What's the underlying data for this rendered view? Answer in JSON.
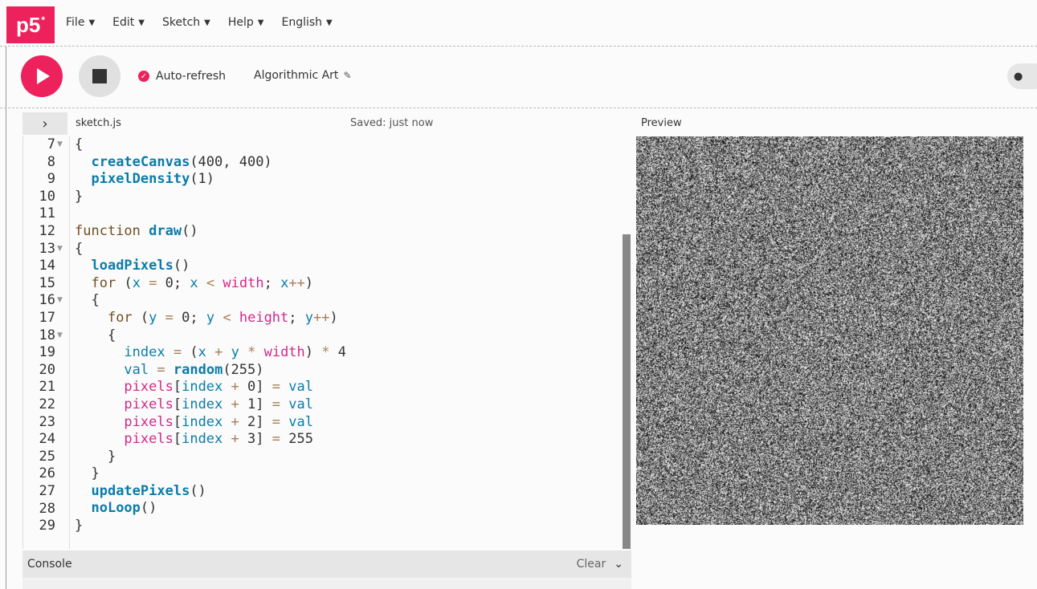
{
  "app": {
    "logo": "p5",
    "logo_sup": "*"
  },
  "menu": [
    {
      "label": "File"
    },
    {
      "label": "Edit"
    },
    {
      "label": "Sketch"
    },
    {
      "label": "Help"
    },
    {
      "label": "English"
    }
  ],
  "toolbar": {
    "auto_refresh_label": "Auto-refresh",
    "sketch_title": "Algorithmic Art"
  },
  "editor": {
    "file_name": "sketch.js",
    "saved_status": "Saved: just now",
    "lines": [
      {
        "n": "7",
        "fold": true
      },
      {
        "n": "8"
      },
      {
        "n": "9"
      },
      {
        "n": "10"
      },
      {
        "n": "11"
      },
      {
        "n": "12"
      },
      {
        "n": "13",
        "fold": true
      },
      {
        "n": "14"
      },
      {
        "n": "15"
      },
      {
        "n": "16",
        "fold": true
      },
      {
        "n": "17"
      },
      {
        "n": "18",
        "fold": true
      },
      {
        "n": "19"
      },
      {
        "n": "20"
      },
      {
        "n": "21"
      },
      {
        "n": "22"
      },
      {
        "n": "23"
      },
      {
        "n": "24"
      },
      {
        "n": "25"
      },
      {
        "n": "26"
      },
      {
        "n": "27"
      },
      {
        "n": "28"
      },
      {
        "n": "29"
      }
    ]
  },
  "preview": {
    "label": "Preview"
  },
  "console": {
    "label": "Console",
    "clear_label": "Clear"
  },
  "colors": {
    "accent": "#ed225d"
  }
}
